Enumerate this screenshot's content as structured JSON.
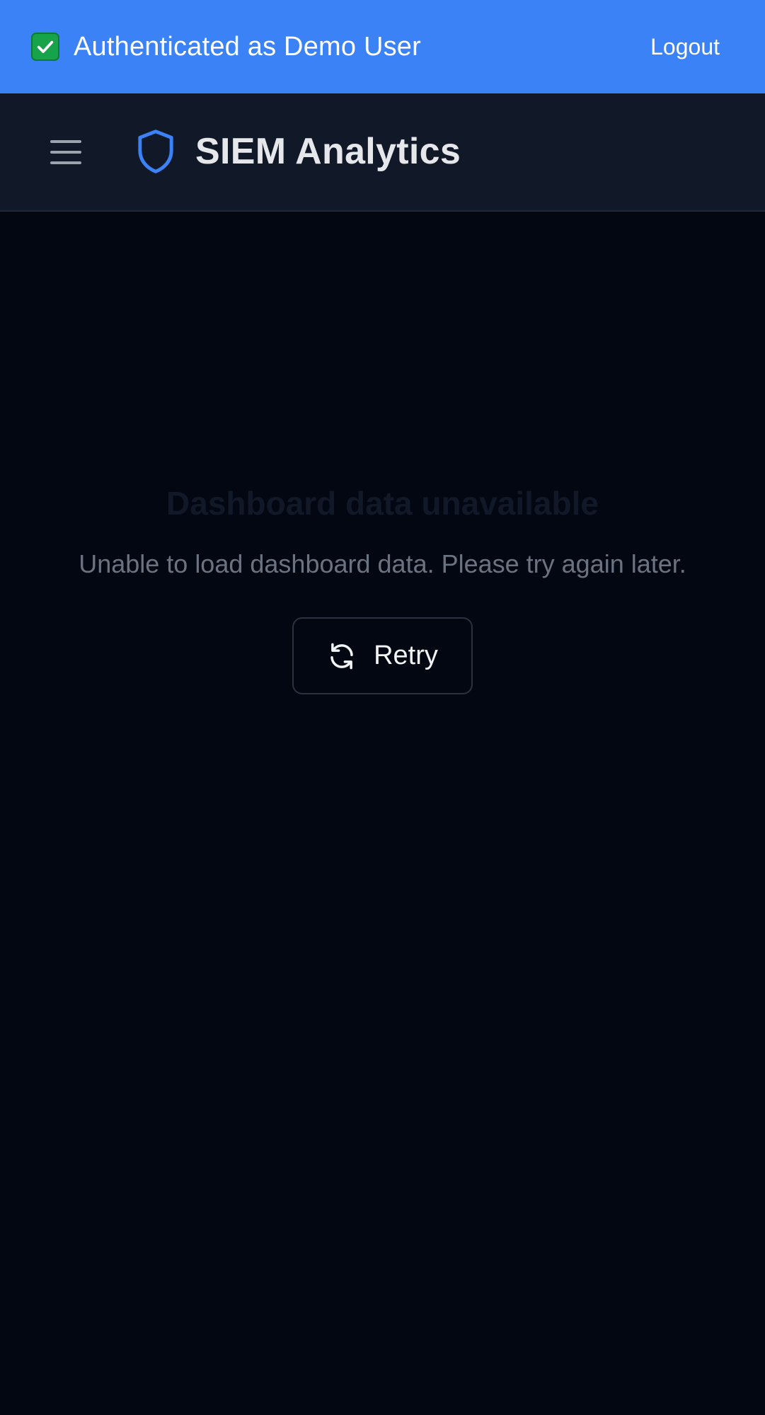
{
  "auth_bar": {
    "status_icon": "check-icon",
    "message": "Authenticated as Demo User",
    "logout_label": "Logout",
    "background": "#3b82f6"
  },
  "header": {
    "menu_icon": "hamburger-menu-icon",
    "logo_icon": "shield-icon",
    "title": "SIEM Analytics",
    "accent": "#3b82f6"
  },
  "main": {
    "error_title": "Dashboard data unavailable",
    "error_message": "Unable to load dashboard data. Please try again later.",
    "retry_icon": "refresh-icon",
    "retry_label": "Retry"
  }
}
